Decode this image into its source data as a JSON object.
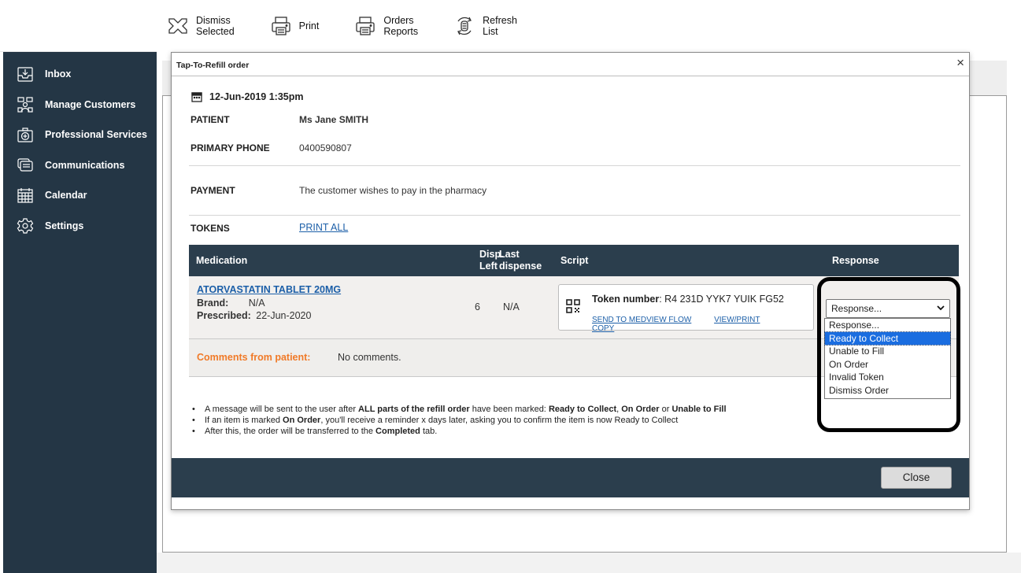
{
  "toolbar": {
    "dismiss_line1": "Dismiss",
    "dismiss_line2": "Selected",
    "print": "Print",
    "orders_line1": "Orders",
    "orders_line2": "Reports",
    "refresh_line1": "Refresh",
    "refresh_line2": "List"
  },
  "sidebar": {
    "items": [
      {
        "label": "Inbox",
        "icon": "inbox-icon"
      },
      {
        "label": "Manage Customers",
        "icon": "customers-icon"
      },
      {
        "label": "Professional Services",
        "icon": "medical-kit-icon"
      },
      {
        "label": "Communications",
        "icon": "messages-icon"
      },
      {
        "label": "Calendar",
        "icon": "calendar-icon"
      },
      {
        "label": "Settings",
        "icon": "gear-icon"
      }
    ]
  },
  "modal": {
    "title": "Tap-To-Refill order",
    "close_x": "×",
    "date": "12-Jun-2019 1:35pm",
    "patient_label": "PATIENT",
    "patient_value": "Ms Jane SMITH",
    "phone_label": "PRIMARY PHONE",
    "phone_value": "0400590807",
    "payment_label": "PAYMENT",
    "payment_value": "The customer wishes to pay in the pharmacy",
    "tokens_label": "TOKENS",
    "tokens_link": "PRINT ALL",
    "table": {
      "headers": {
        "medication": "Medication",
        "disp_left_1": "Disp.",
        "disp_left_2": "Left",
        "last_dispense_1": "Last",
        "last_dispense_2": "dispense",
        "script": "Script",
        "response": "Response"
      },
      "row": {
        "medication_name": "ATORVASTATIN TABLET 20MG",
        "brand_label": "Brand:",
        "brand_value": "N/A",
        "prescribed_label": "Prescribed:",
        "prescribed_value": "22-Jun-2020",
        "disp_left": "6",
        "last_dispense": "N/A",
        "token_label": "Token number",
        "token_value": ": R4 231D YYK7 YUIK FG52",
        "send_link": "SEND TO MEDVIEW FLOW",
        "view_link": "VIEW/PRINT",
        "copy_link": "COPY"
      },
      "comments_label": "Comments from patient:",
      "comments_value": "No comments."
    },
    "response": {
      "selected": "Response...",
      "options": [
        "Response...",
        "Ready to Collect",
        "Unable to Fill",
        "On Order",
        "Invalid Token",
        "Dismiss Order"
      ],
      "highlighted": "Ready to Collect"
    },
    "notes": {
      "n1_a": "A message will be sent to the user after ",
      "n1_b": "ALL parts of the refill order",
      "n1_c": " have been marked: ",
      "n1_d": "Ready to Collect",
      "n1_e": ", ",
      "n1_f": "On Order",
      "n1_g": " or ",
      "n1_h": "Unable to Fill",
      "n2_a": "If an item is marked ",
      "n2_b": "On Order",
      "n2_c": ", you'll receive a reminder x days later, asking you to confirm the item is now Ready to Collect",
      "n3_a": "After this, the order will be transferred to the ",
      "n3_b": "Completed",
      "n3_c": " tab."
    },
    "close_button": "Close"
  },
  "colors": {
    "sidebar_bg": "#243645",
    "header_bg": "#2b3e4d",
    "link": "#1c5fa8",
    "comments_label": "#f07a28",
    "selected_option": "#1a6de0"
  }
}
